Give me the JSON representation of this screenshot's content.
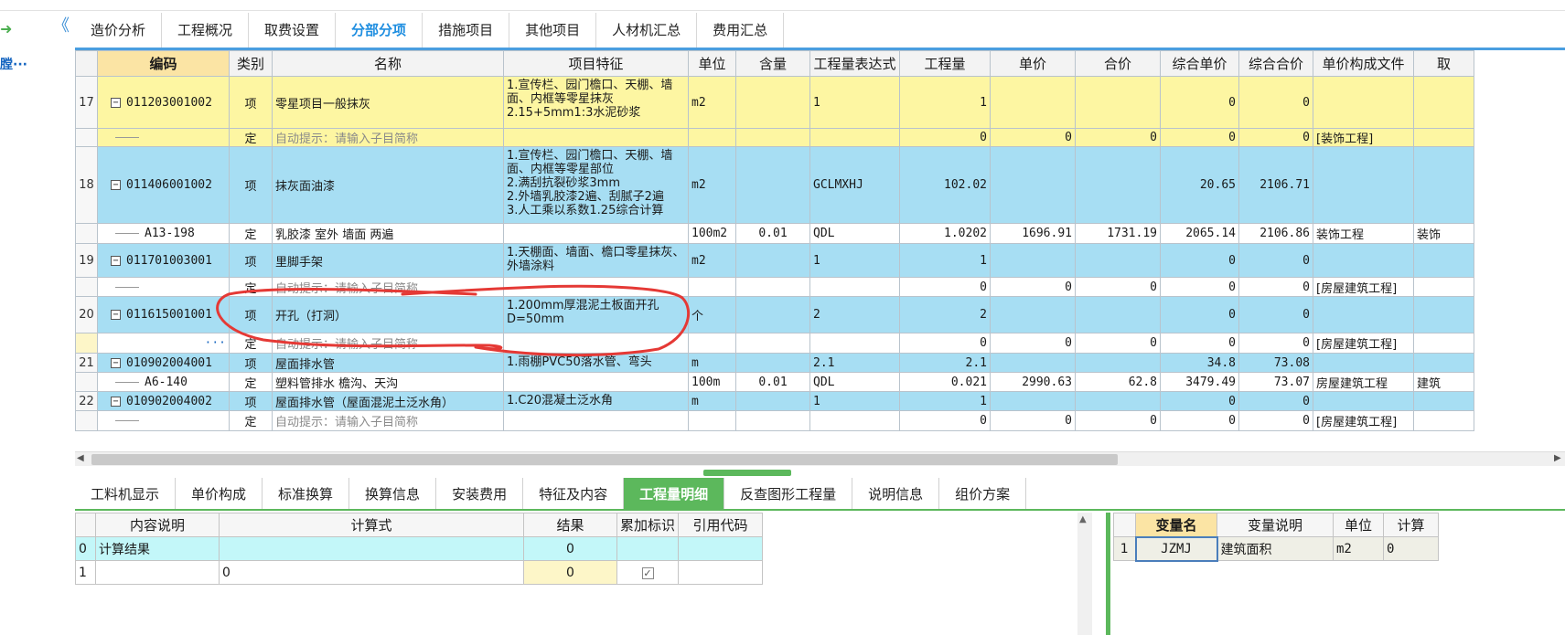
{
  "left_panel": {
    "arrow_glyph": "➜",
    "label": "膛···",
    "collapse_glyph": "《"
  },
  "top_tabs": [
    {
      "label": "造价分析",
      "active": false
    },
    {
      "label": "工程概况",
      "active": false
    },
    {
      "label": "取费设置",
      "active": false
    },
    {
      "label": "分部分项",
      "active": true
    },
    {
      "label": "措施项目",
      "active": false
    },
    {
      "label": "其他项目",
      "active": false
    },
    {
      "label": "人材机汇总",
      "active": false
    },
    {
      "label": "费用汇总",
      "active": false
    }
  ],
  "grid": {
    "columns": [
      "编码",
      "类别",
      "名称",
      "项目特征",
      "单位",
      "含量",
      "工程量表达式",
      "工程量",
      "单价",
      "合价",
      "综合单价",
      "综合合价",
      "单价构成文件",
      "取"
    ],
    "rows": [
      {
        "kind": "item",
        "no": "17",
        "code": "011203001002",
        "type": "项",
        "name": "零星项目一般抹灰",
        "features": [
          "1.宣传栏、园门檐口、天棚、墙面、内框等零星抹灰",
          "2.15+5mm1:3水泥砂浆"
        ],
        "unit": "m2",
        "content": "",
        "expr": "1",
        "qty": "1",
        "price": "",
        "total": "",
        "uprice": "0",
        "utotal": "0",
        "file": "",
        "extra": ""
      },
      {
        "kind": "sub",
        "no": "",
        "code": "",
        "type": "定",
        "name": "自动提示：请输入子目简称",
        "features": [],
        "unit": "",
        "content": "",
        "expr": "",
        "qty": "0",
        "price": "0",
        "total": "0",
        "uprice": "0",
        "utotal": "0",
        "file": "[装饰工程]",
        "extra": ""
      },
      {
        "kind": "item",
        "no": "18",
        "code": "011406001002",
        "type": "项",
        "name": "抹灰面油漆",
        "features": [
          "1.宣传栏、园门檐口、天棚、墙面、内框等零星部位",
          "2.满刮抗裂砂浆3mm",
          "2.外墙乳胶漆2遍、刮腻子2遍",
          "3.人工乘以系数1.25综合计算"
        ],
        "unit": "m2",
        "content": "",
        "expr": "GCLMXHJ",
        "qty": "102.02",
        "price": "",
        "total": "",
        "uprice": "20.65",
        "utotal": "2106.71",
        "file": "",
        "extra": ""
      },
      {
        "kind": "sub",
        "no": "",
        "code": "A13-198",
        "type": "定",
        "name": "乳胶漆 室外 墙面 两遍",
        "features": [],
        "unit": "100m2",
        "content": "0.01",
        "expr": "QDL",
        "qty": "1.0202",
        "price": "1696.91",
        "total": "1731.19",
        "uprice": "2065.14",
        "utotal": "2106.86",
        "file": "装饰工程",
        "extra": "装饰"
      },
      {
        "kind": "item",
        "no": "19",
        "code": "011701003001",
        "type": "项",
        "name": "里脚手架",
        "features": [
          "1.天棚面、墙面、檐口零星抹灰、外墙涂料"
        ],
        "unit": "m2",
        "content": "",
        "expr": "1",
        "qty": "1",
        "price": "",
        "total": "",
        "uprice": "0",
        "utotal": "0",
        "file": "",
        "extra": ""
      },
      {
        "kind": "sub",
        "no": "",
        "code": "",
        "type": "定",
        "name": "自动提示：请输入子目简称",
        "features": [],
        "unit": "",
        "content": "",
        "expr": "",
        "qty": "0",
        "price": "0",
        "total": "0",
        "uprice": "0",
        "utotal": "0",
        "file": "[房屋建筑工程]",
        "extra": ""
      },
      {
        "kind": "item",
        "no": "20",
        "code": "011615001001",
        "type": "项",
        "name": "开孔（打洞）",
        "features": [
          "1.200mm厚混泥土板面开孔",
          "D=50mm"
        ],
        "unit": "个",
        "content": "",
        "expr": "2",
        "qty": "2",
        "price": "",
        "total": "",
        "uprice": "0",
        "utotal": "0",
        "file": "",
        "extra": ""
      },
      {
        "kind": "sub-edit",
        "no": "",
        "code": "···",
        "type": "定",
        "name": "自动提示：请输入子目简称",
        "features": [],
        "unit": "",
        "content": "",
        "expr": "",
        "qty": "0",
        "price": "0",
        "total": "0",
        "uprice": "0",
        "utotal": "0",
        "file": "[房屋建筑工程]",
        "extra": ""
      },
      {
        "kind": "item",
        "no": "21",
        "code": "010902004001",
        "type": "项",
        "name": "屋面排水管",
        "features": [
          "1.雨棚PVC50落水管、弯头"
        ],
        "unit": "m",
        "content": "",
        "expr": "2.1",
        "qty": "2.1",
        "price": "",
        "total": "",
        "uprice": "34.8",
        "utotal": "73.08",
        "file": "",
        "extra": ""
      },
      {
        "kind": "sub",
        "no": "",
        "code": "A6-140",
        "type": "定",
        "name": "塑料管排水 檐沟、天沟",
        "features": [],
        "unit": "100m",
        "content": "0.01",
        "expr": "QDL",
        "qty": "0.021",
        "price": "2990.63",
        "total": "62.8",
        "uprice": "3479.49",
        "utotal": "73.07",
        "file": "房屋建筑工程",
        "extra": "建筑"
      },
      {
        "kind": "item",
        "no": "22",
        "code": "010902004002",
        "type": "项",
        "name": "屋面排水管（屋面混泥土泛水角）",
        "features": [
          "1.C20混凝土泛水角"
        ],
        "unit": "m",
        "content": "",
        "expr": "1",
        "qty": "1",
        "price": "",
        "total": "",
        "uprice": "0",
        "utotal": "0",
        "file": "",
        "extra": ""
      },
      {
        "kind": "sub",
        "no": "",
        "code": "",
        "type": "定",
        "name": "自动提示：请输入子目简称",
        "features": [],
        "unit": "",
        "content": "",
        "expr": "",
        "qty": "0",
        "price": "0",
        "total": "0",
        "uprice": "0",
        "utotal": "0",
        "file": "[房屋建筑工程]",
        "extra": ""
      }
    ]
  },
  "bottom_tabs": [
    {
      "label": "工料机显示",
      "active": false
    },
    {
      "label": "单价构成",
      "active": false
    },
    {
      "label": "标准换算",
      "active": false
    },
    {
      "label": "换算信息",
      "active": false
    },
    {
      "label": "安装费用",
      "active": false
    },
    {
      "label": "特征及内容",
      "active": false
    },
    {
      "label": "工程量明细",
      "active": true
    },
    {
      "label": "反查图形工程量",
      "active": false
    },
    {
      "label": "说明信息",
      "active": false
    },
    {
      "label": "组价方案",
      "active": false
    }
  ],
  "calc_table": {
    "columns": [
      "内容说明",
      "计算式",
      "结果",
      "累加标识",
      "引用代码"
    ],
    "rows": [
      {
        "no": "0",
        "desc": "计算结果",
        "formula": "",
        "result": "0",
        "flag": "",
        "ref": ""
      },
      {
        "no": "1",
        "desc": "",
        "formula": "0",
        "result": "0",
        "flag": "✓",
        "ref": ""
      }
    ]
  },
  "var_table": {
    "columns": [
      "变量名",
      "变量说明",
      "单位",
      "计算"
    ],
    "rows": [
      {
        "no": "1",
        "name": "JZMJ",
        "desc": "建筑面积",
        "unit": "m2",
        "calc": "0"
      }
    ]
  },
  "colors": {
    "item_row": "#a7def3",
    "yellow_row": "#fdf6a2",
    "active_tab": "#1f8ee0",
    "bottom_active": "#5cb85c",
    "annotation": "#e53935"
  }
}
